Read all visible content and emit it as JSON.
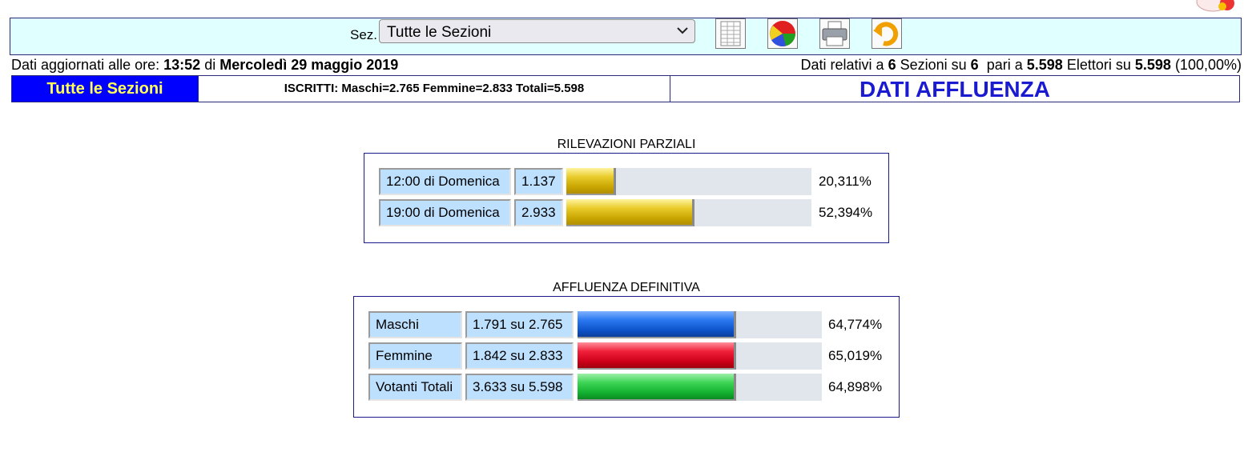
{
  "toolbar": {
    "sez_label": "Sez.",
    "sez_value": "Tutte le Sezioni",
    "icons": [
      "spreadsheet-icon",
      "pie-chart-icon",
      "printer-icon",
      "back-arrow-icon"
    ]
  },
  "info": {
    "prefix": "Dati aggiornati alle ore:",
    "time": "13:52",
    "di": "di",
    "date": "Mercoledì 29 maggio 2019",
    "r1": "Dati relativi a",
    "sezioni_count": "6",
    "r2": "Sezioni su",
    "sezioni_total": "6",
    "r3": "pari a",
    "elettori_count": "5.598",
    "r4": "Elettori su",
    "elettori_total": "5.598",
    "elettori_pct": "(100,00%)"
  },
  "header": {
    "sezione": "Tutte le Sezioni",
    "iscritti": "ISCRITTI: Maschi=2.765 Femmine=2.833 Totali=5.598",
    "title": "DATI AFFLUENZA"
  },
  "parziali": {
    "title": "RILEVAZIONI PARZIALI",
    "rows": [
      {
        "label": "12:00 di Domenica",
        "value": "1.137",
        "fraction": 0.20311,
        "pct": "20,311%",
        "color": "#d4b300"
      },
      {
        "label": "19:00 di Domenica",
        "value": "2.933",
        "fraction": 0.52394,
        "pct": "52,394%",
        "color": "#d4b300"
      }
    ]
  },
  "definitiva": {
    "title": "AFFLUENZA DEFINITIVA",
    "rows": [
      {
        "label": "Maschi",
        "value": "1.791 su 2.765",
        "fraction": 0.64774,
        "pct": "64,774%",
        "color": "#1060e0"
      },
      {
        "label": "Femmine",
        "value": "1.842 su 2.833",
        "fraction": 0.65019,
        "pct": "65,019%",
        "color": "#e0001c"
      },
      {
        "label": "Votanti Totali",
        "value": "3.633 su 5.598",
        "fraction": 0.64898,
        "pct": "64,898%",
        "color": "#20c040"
      }
    ]
  }
}
